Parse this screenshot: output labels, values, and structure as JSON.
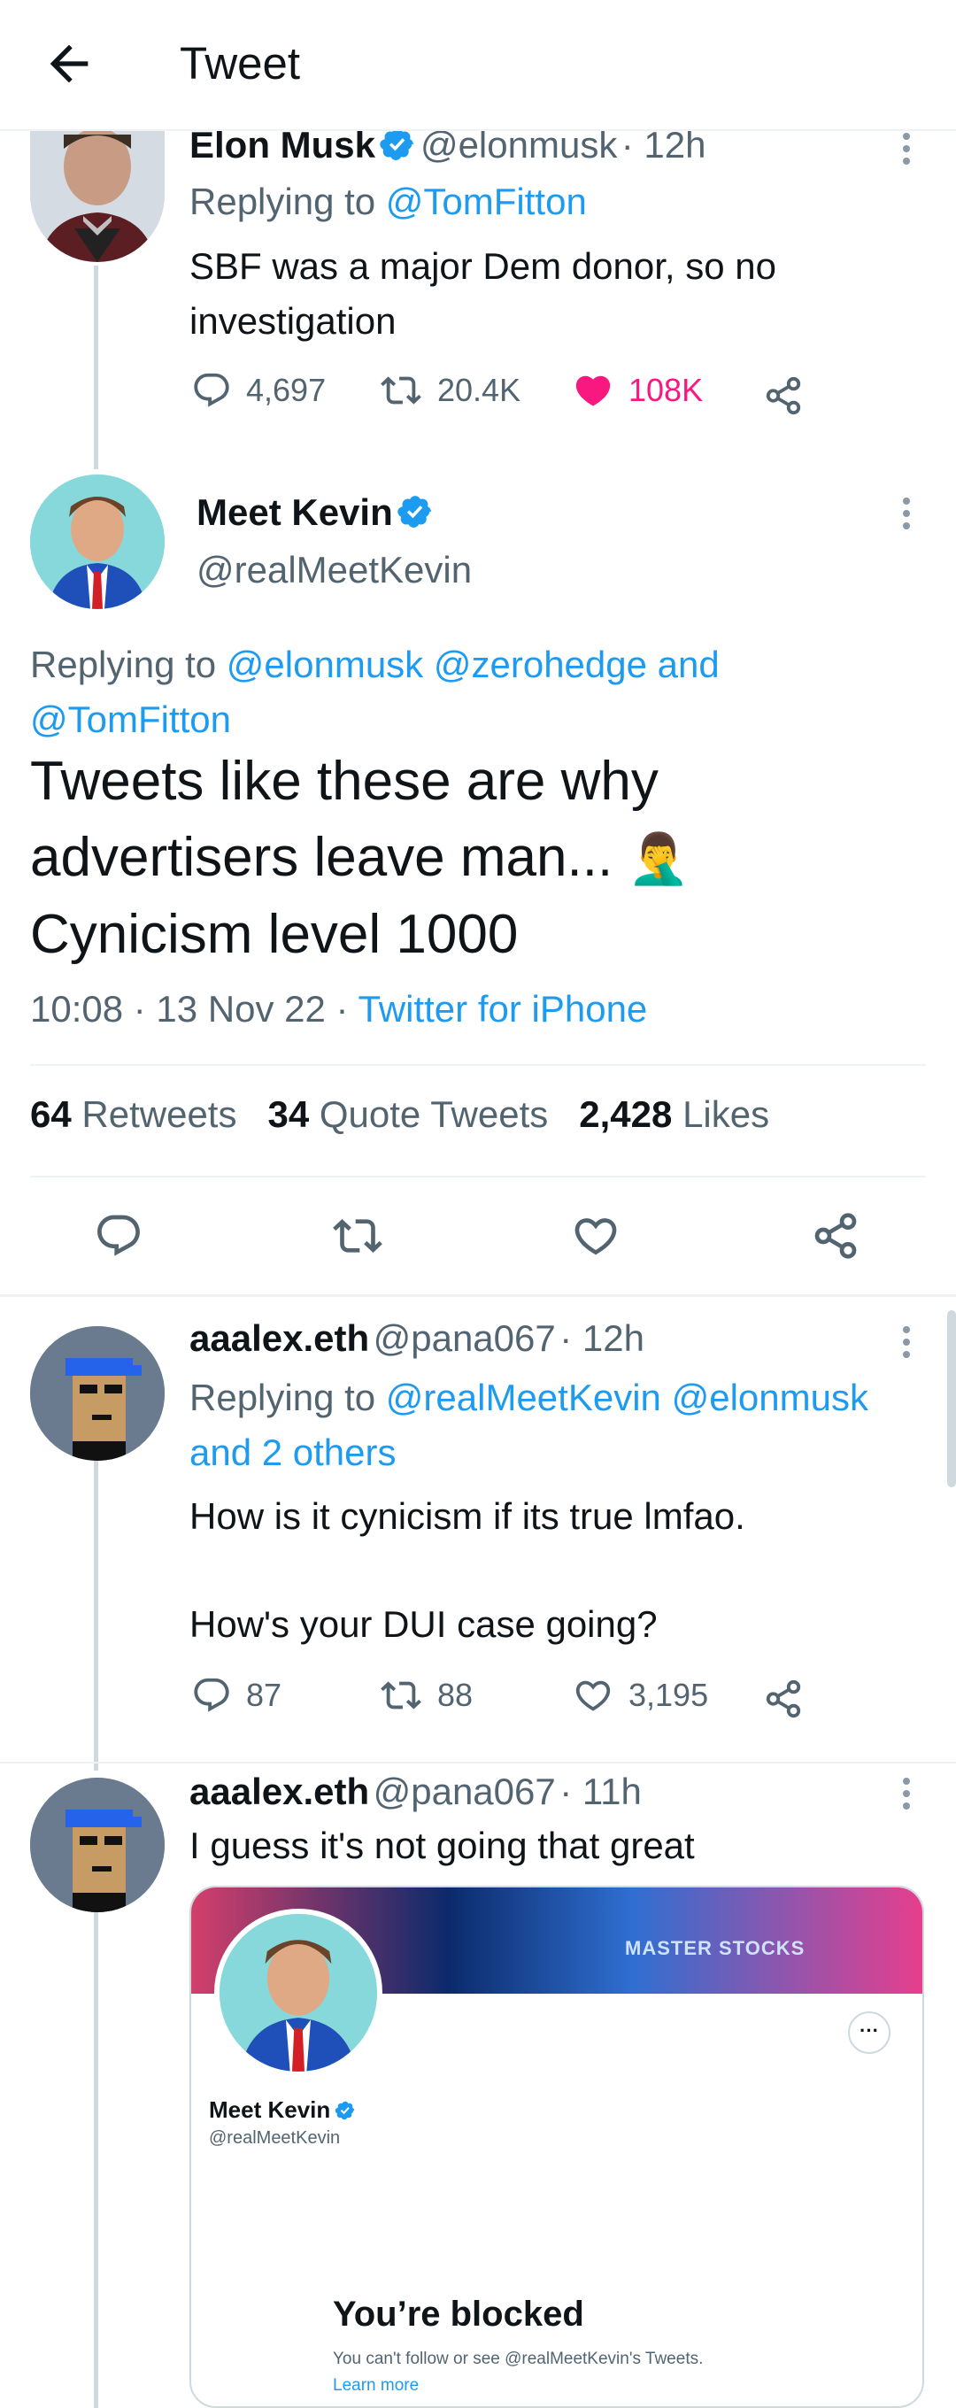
{
  "header": {
    "title": "Tweet",
    "back_icon": "arrow-left-icon"
  },
  "colors": {
    "accent": "#1d9bf0",
    "like": "#f91880",
    "muted": "#536471"
  },
  "tweet1": {
    "name": "Elon Musk",
    "handle": "@elonmusk",
    "time": "· 12h",
    "replying_prefix": "Replying to",
    "replying_to": "@TomFitton",
    "text": "SBF was a major Dem donor, so no investigation",
    "replies": "4,697",
    "retweets": "20.4K",
    "likes": "108K",
    "liked": true
  },
  "main": {
    "name": "Meet Kevin",
    "handle": "@realMeetKevin",
    "replying_prefix": "Replying to",
    "replying_to": "@elonmusk @zerohedge and",
    "replying_to_2": "@TomFitton",
    "text_line1": "Tweets like these are why",
    "text_line2": "advertisers leave man...",
    "emoji": "🤦‍♂️",
    "text_line3": "Cynicism level 1000",
    "timestamp": "10:08 · 13 Nov 22 ·",
    "source": "Twitter for iPhone",
    "retweets_count": "64",
    "retweets_label": "Retweets",
    "quotes_count": "34",
    "quotes_label": "Quote Tweets",
    "likes_count": "2,428",
    "likes_label": "Likes"
  },
  "reply1": {
    "name": "aaalex.eth",
    "handle": "@pana067",
    "time": "· 12h",
    "replying_prefix": "Replying to",
    "replying_to": "@realMeetKevin @elonmusk",
    "replying_to_2": "and 2 others",
    "text_p1": "How is it cynicism if its true lmfao.",
    "text_p2": "How's your DUI case going?",
    "replies": "87",
    "retweets": "88",
    "likes": "3,195"
  },
  "reply2": {
    "name": "aaalex.eth",
    "handle": "@pana067",
    "time": "· 11h",
    "text": "I guess it's not going that great",
    "card": {
      "banner_text": "MASTER STOCKS",
      "profile_name": "Meet Kevin",
      "profile_handle": "@realMeetKevin",
      "more_label": "···",
      "blocked_title": "You’re blocked",
      "blocked_text": "You can't follow or see @realMeetKevin's Tweets.",
      "learn_more": "Learn more"
    }
  }
}
